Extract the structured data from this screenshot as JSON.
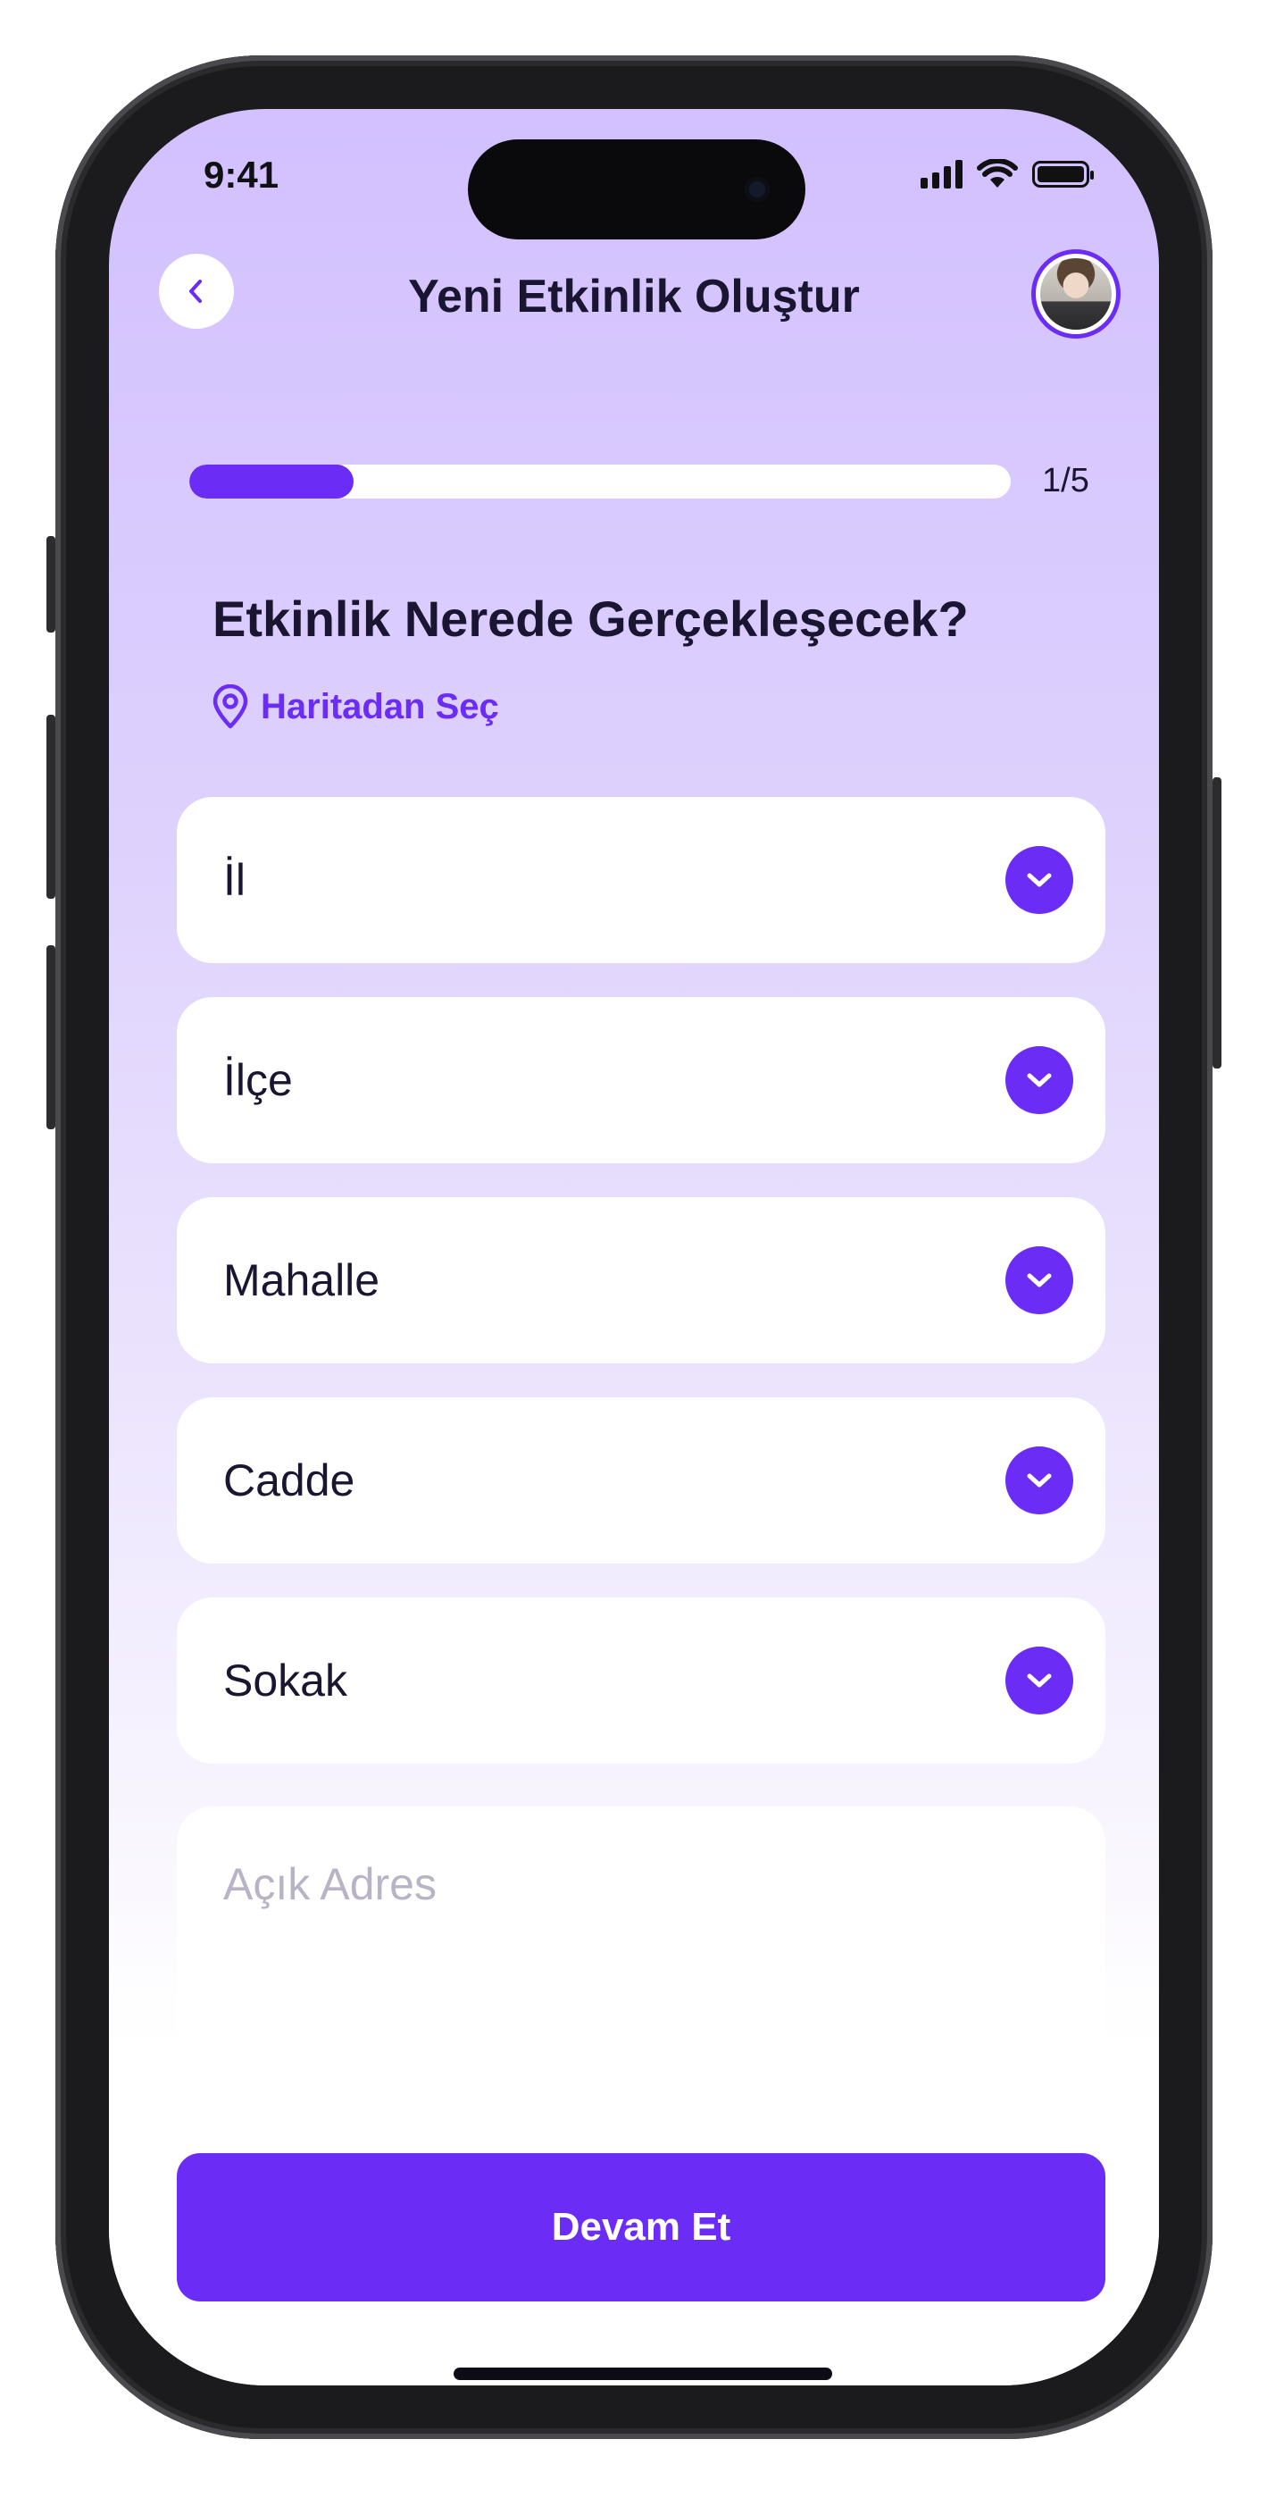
{
  "status_bar": {
    "time": "9:41"
  },
  "header": {
    "title": "Yeni Etkinlik Oluştur"
  },
  "progress": {
    "fraction": 0.2,
    "label": "1/5"
  },
  "question": "Etkinlik Nerede Gerçekleşecek?",
  "map_link": {
    "label": "Haritadan Seç",
    "icon": "location-pin-icon"
  },
  "fields": {
    "il": "İl",
    "ilce": "İlçe",
    "mahalle": "Mahalle",
    "cadde": "Cadde",
    "sokak": "Sokak"
  },
  "address": {
    "placeholder": "Açık Adres",
    "value": ""
  },
  "cta": {
    "label": "Devam Et"
  },
  "colors": {
    "accent": "#6b2cf5",
    "text": "#1a1530",
    "placeholder": "#b9b3c6"
  }
}
